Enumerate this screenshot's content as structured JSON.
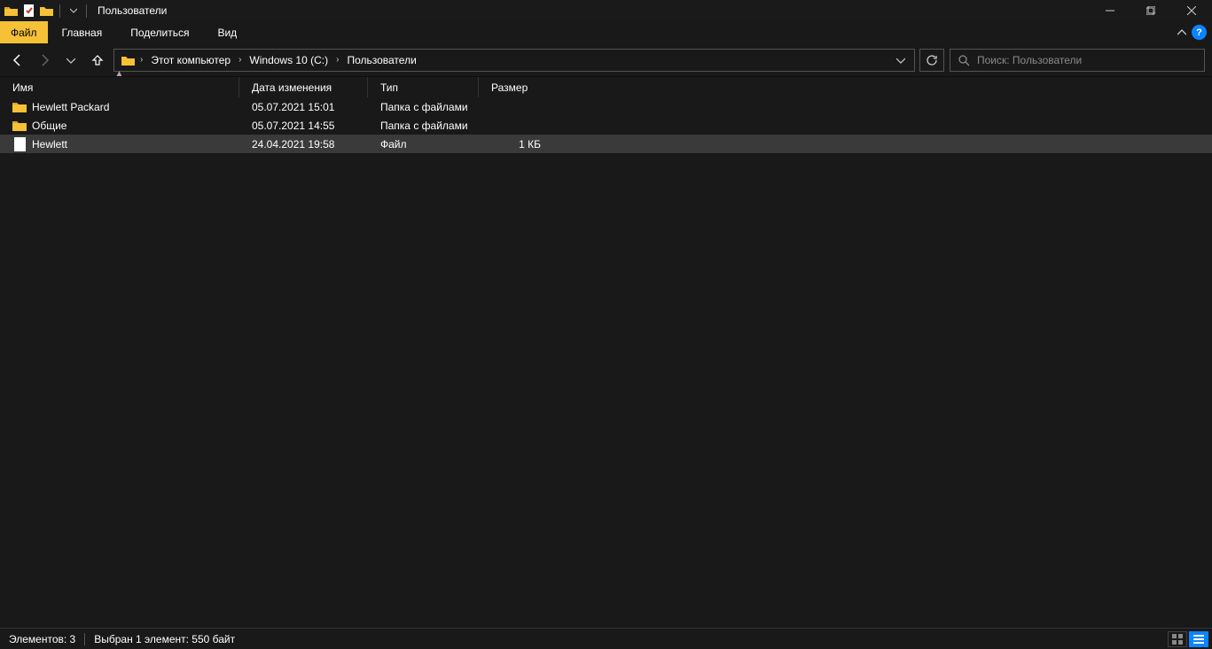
{
  "window": {
    "title": "Пользователи"
  },
  "ribbon": {
    "file": "Файл",
    "tabs": [
      "Главная",
      "Поделиться",
      "Вид"
    ]
  },
  "breadcrumb": {
    "items": [
      "Этот компьютер",
      "Windows 10 (C:)",
      "Пользователи"
    ]
  },
  "search": {
    "placeholder": "Поиск: Пользователи"
  },
  "columns": {
    "name": "Имя",
    "date": "Дата изменения",
    "type": "Тип",
    "size": "Размер"
  },
  "rows": [
    {
      "icon": "folder",
      "name": "Hewlett Packard",
      "date": "05.07.2021 15:01",
      "type": "Папка с файлами",
      "size": "",
      "selected": false
    },
    {
      "icon": "folder",
      "name": "Общие",
      "date": "05.07.2021 14:55",
      "type": "Папка с файлами",
      "size": "",
      "selected": false
    },
    {
      "icon": "file",
      "name": "Hewlett",
      "date": "24.04.2021 19:58",
      "type": "Файл",
      "size": "1 КБ",
      "selected": true
    }
  ],
  "status": {
    "count": "Элементов: 3",
    "selection": "Выбран 1 элемент: 550 байт"
  }
}
